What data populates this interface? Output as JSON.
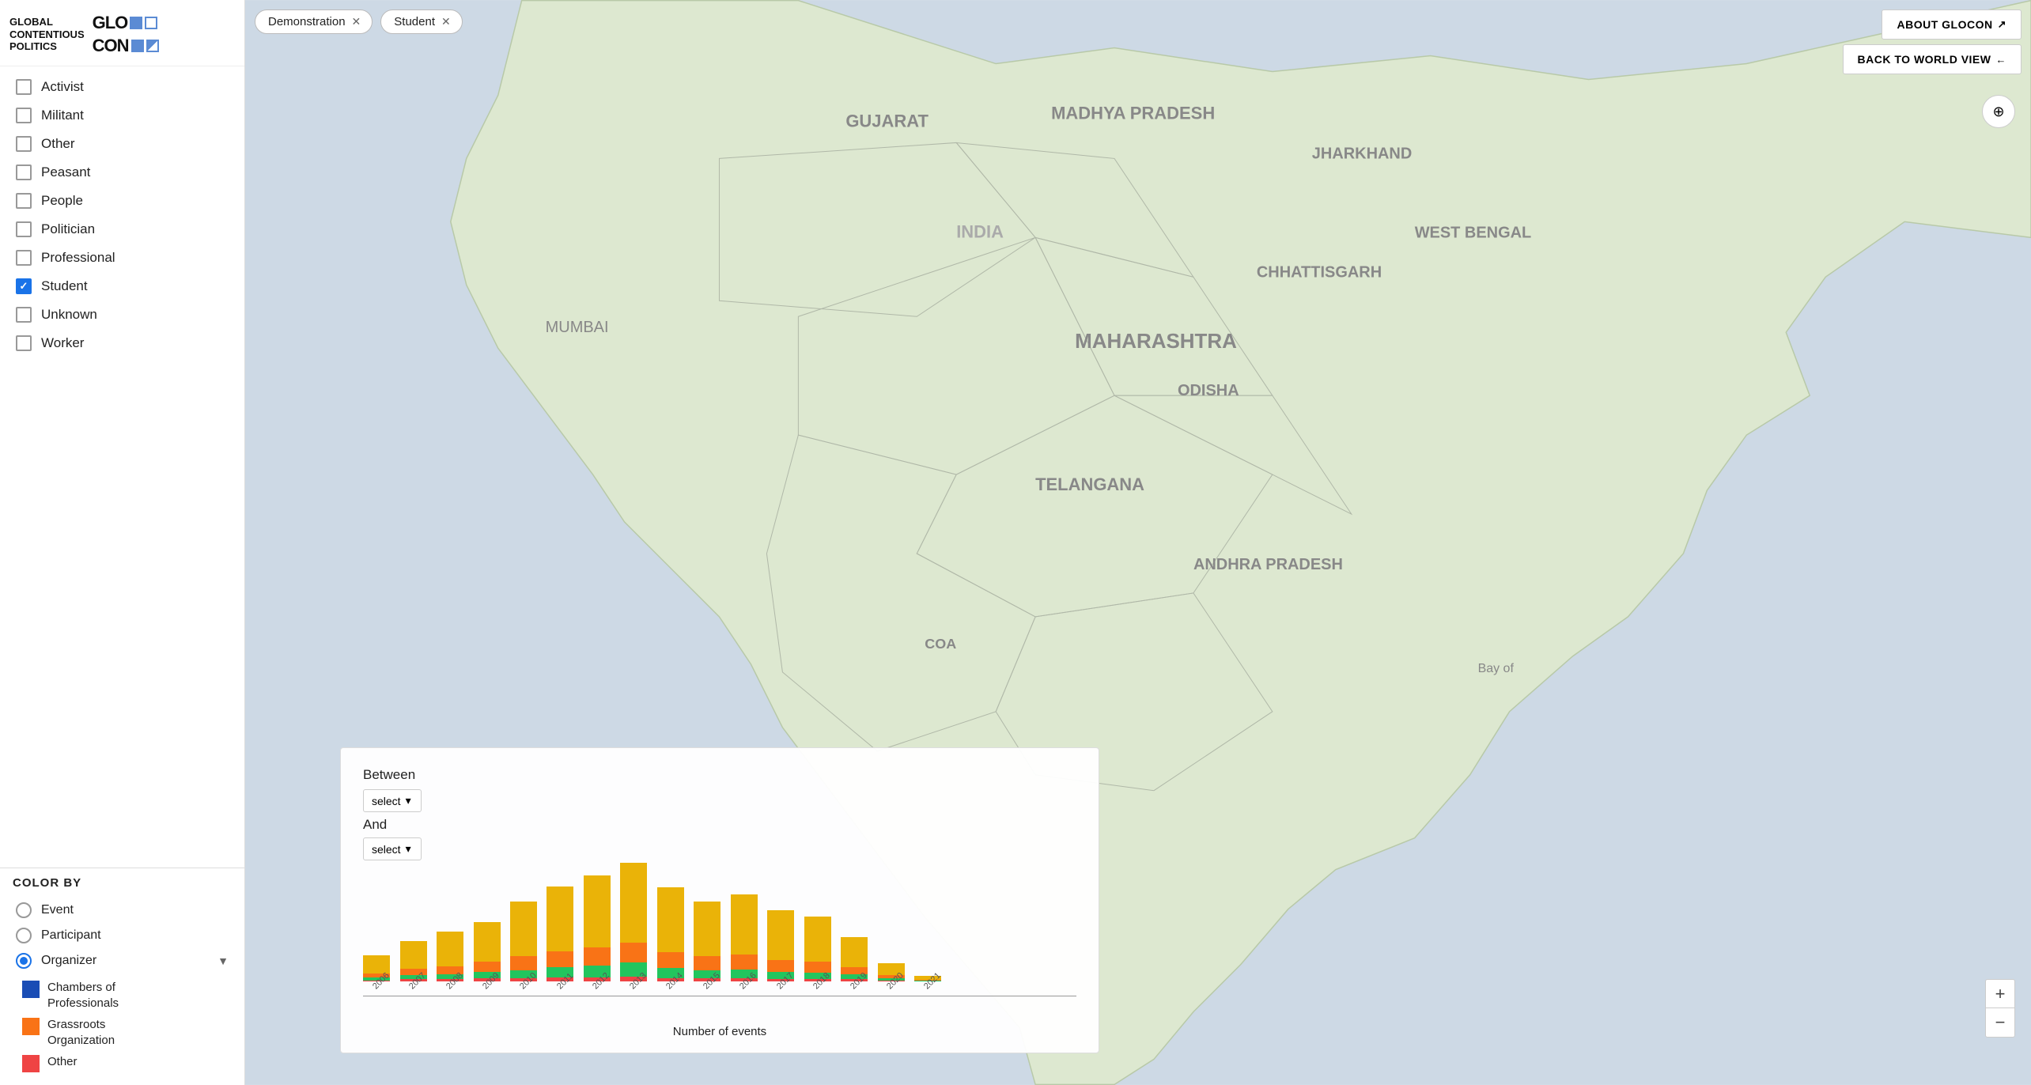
{
  "logo": {
    "line1": "GLOBAL",
    "line2": "CONTENTIOUS",
    "line3": "POLITICS",
    "glo": "GLO",
    "con": "CON"
  },
  "filters": [
    {
      "label": "Demonstration",
      "id": "demonstration"
    },
    {
      "label": "Student",
      "id": "student"
    }
  ],
  "topButtons": {
    "about": "ABOUT GLOCON",
    "backToWorld": "BACK TO WORLD VIEW"
  },
  "checkboxItems": [
    {
      "label": "Activist",
      "checked": false
    },
    {
      "label": "Militant",
      "checked": false
    },
    {
      "label": "Other",
      "checked": false
    },
    {
      "label": "Peasant",
      "checked": false
    },
    {
      "label": "People",
      "checked": false
    },
    {
      "label": "Politician",
      "checked": false
    },
    {
      "label": "Professional",
      "checked": false
    },
    {
      "label": "Student",
      "checked": true
    },
    {
      "label": "Unknown",
      "checked": false
    },
    {
      "label": "Worker",
      "checked": false
    }
  ],
  "colorBy": {
    "title": "COLOR BY",
    "options": [
      {
        "label": "Event",
        "selected": false
      },
      {
        "label": "Participant",
        "selected": false
      },
      {
        "label": "Organizer",
        "selected": true
      }
    ],
    "legend": [
      {
        "color": "#1a4db5",
        "label": "Chambers of\nProfessionals"
      },
      {
        "color": "#f97316",
        "label": "Grassroots\nOrganization"
      },
      {
        "color": "#ef4444",
        "label": "Other"
      }
    ]
  },
  "chart": {
    "between_label": "Between",
    "and_label": "And",
    "select_placeholder": "select",
    "xlabel": "Number of events",
    "years": [
      "2006",
      "2007",
      "2008",
      "2009",
      "2010",
      "2011",
      "2012",
      "2013",
      "2014",
      "2015",
      "2016",
      "2017",
      "2018",
      "2019",
      "2020",
      "2021"
    ],
    "bars": [
      {
        "yellow": 18,
        "orange": 4,
        "green": 3,
        "red": 1
      },
      {
        "yellow": 28,
        "orange": 6,
        "green": 4,
        "red": 2
      },
      {
        "yellow": 35,
        "orange": 8,
        "green": 5,
        "red": 2
      },
      {
        "yellow": 40,
        "orange": 10,
        "green": 6,
        "red": 3
      },
      {
        "yellow": 55,
        "orange": 14,
        "green": 8,
        "red": 3
      },
      {
        "yellow": 65,
        "orange": 16,
        "green": 10,
        "red": 4
      },
      {
        "yellow": 72,
        "orange": 18,
        "green": 12,
        "red": 4
      },
      {
        "yellow": 80,
        "orange": 20,
        "green": 14,
        "red": 5
      },
      {
        "yellow": 65,
        "orange": 16,
        "green": 10,
        "red": 3
      },
      {
        "yellow": 55,
        "orange": 14,
        "green": 8,
        "red": 3
      },
      {
        "yellow": 60,
        "orange": 15,
        "green": 9,
        "red": 3
      },
      {
        "yellow": 50,
        "orange": 12,
        "green": 7,
        "red": 2
      },
      {
        "yellow": 45,
        "orange": 11,
        "green": 6,
        "red": 2
      },
      {
        "yellow": 30,
        "orange": 7,
        "green": 5,
        "red": 2
      },
      {
        "yellow": 12,
        "orange": 3,
        "green": 2,
        "red": 1
      },
      {
        "yellow": 4,
        "orange": 1,
        "green": 1,
        "red": 0
      }
    ]
  }
}
